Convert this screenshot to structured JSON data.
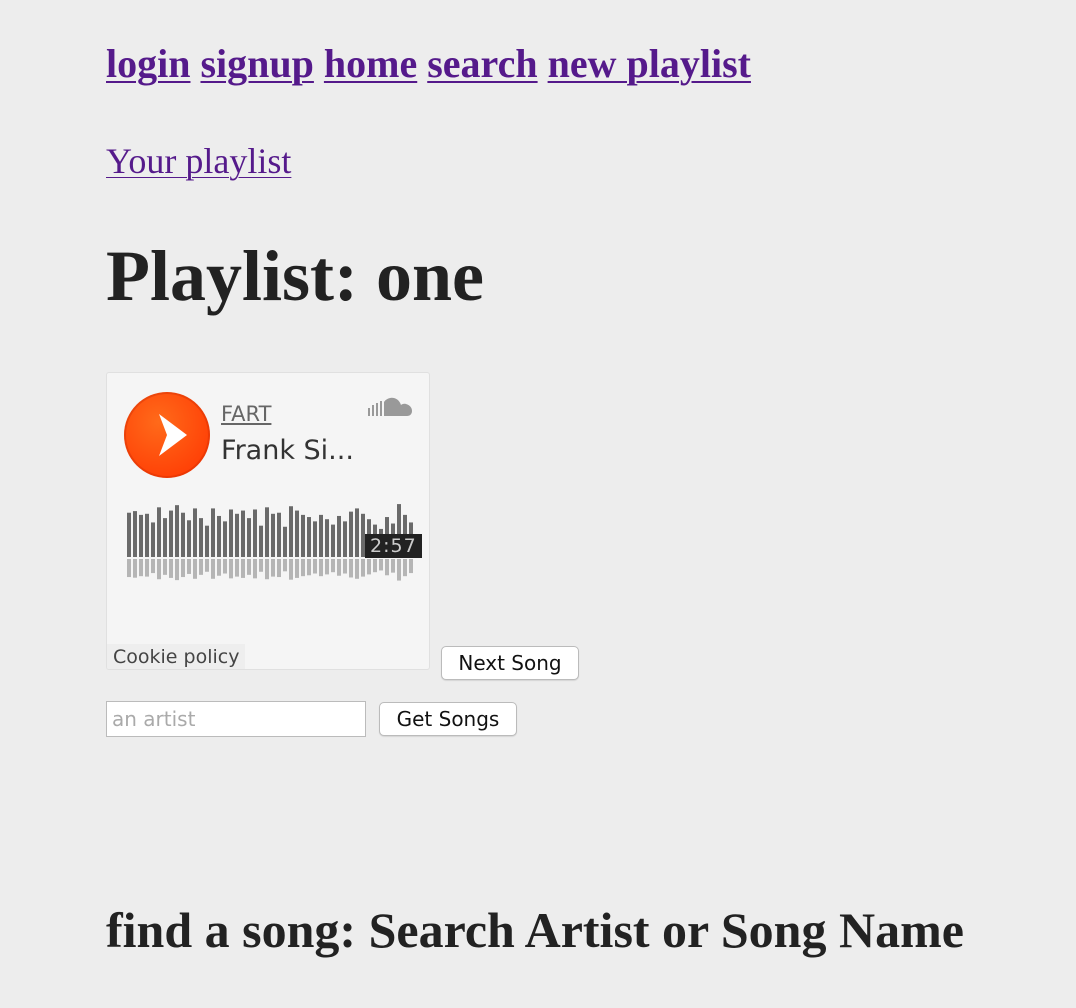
{
  "nav": {
    "links": [
      "login",
      "signup",
      "home",
      "search",
      "new playlist"
    ]
  },
  "your_playlist_link": "Your playlist",
  "page_title": "Playlist: one",
  "player": {
    "artist": "FART",
    "track_title": "Frank Si...",
    "duration": "2:57",
    "cookie_policy": "Cookie policy",
    "accent_color": "#ff5500",
    "logo_icon": "soundcloud-logo-icon",
    "play_icon": "play-icon"
  },
  "next_song_label": "Next Song",
  "artist_search": {
    "value": "",
    "placeholder": "an artist"
  },
  "get_songs_label": "Get Songs",
  "find_heading": "find a song: Search Artist or Song Name"
}
